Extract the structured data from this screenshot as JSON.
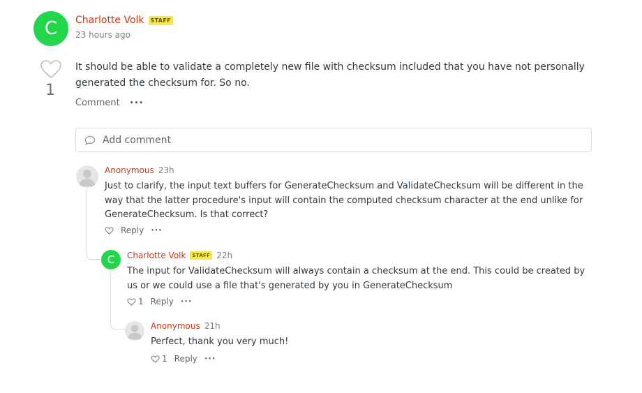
{
  "post": {
    "author_initial": "C",
    "author_name": "Charlotte Volk",
    "staff_label": "STAFF",
    "time": "23 hours ago",
    "vote_count": "1",
    "body": "It should be able to validate a completely new file with checksum included that you have not personally generated the checksum for. So no.",
    "comment_label": "Comment",
    "more_label": "•••"
  },
  "add_comment": {
    "label": "Add comment"
  },
  "comments": [
    {
      "author": "Anonymous",
      "time": "23h",
      "body": "Just to clarify, the input text buffers for GenerateChecksum and ValidateChecksum will be different in the way that the latter procedure's input will contain the computed checksum character at the end unlike for GenerateChecksum. Is that correct?",
      "like_count": "",
      "reply_label": "Reply",
      "more_label": "•••"
    },
    {
      "author_initial": "C",
      "author": "Charlotte Volk",
      "staff_label": "STAFF",
      "time": "22h",
      "body": "The input for ValidateChecksum will always contain a checksum at the end. This could be created by us or we could use a file that's generated by you in GenerateChecksum",
      "like_count": "1",
      "reply_label": "Reply",
      "more_label": "•••"
    },
    {
      "author": "Anonymous",
      "time": "21h",
      "body": "Perfect, thank you very much!",
      "like_count": "1",
      "reply_label": "Reply",
      "more_label": "•••"
    }
  ],
  "colors": {
    "avatar_green": "#22d64b",
    "author_red": "#d6330f",
    "staff_yellow": "#f7e64a"
  }
}
